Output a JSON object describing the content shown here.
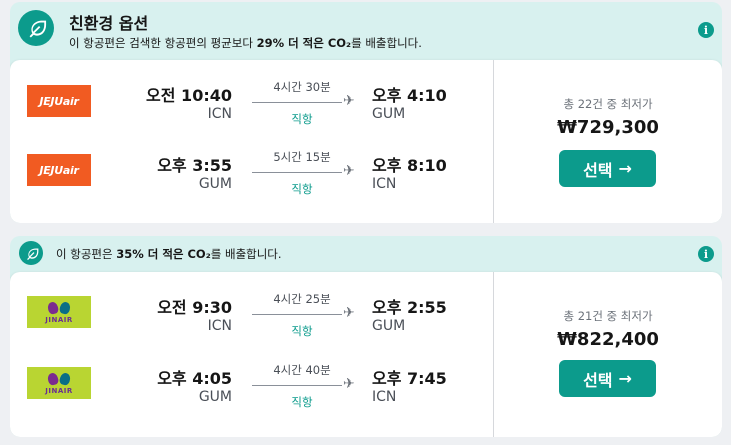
{
  "results": [
    {
      "eco_title": "친환경 옵션",
      "eco_desc_pre": "이 항공편은 검색한 항공편의 평균보다 ",
      "eco_desc_bold": "29% 더 적은 CO₂",
      "eco_desc_post": "를 배출합니다.",
      "info_glyph": "i",
      "legs": [
        {
          "airline": "JEJUair",
          "logo_color": "#f15b22",
          "dep_time": "오전 10:40",
          "dep_code": "ICN",
          "duration": "4시간 30분",
          "stops": "직항",
          "arr_time": "오후 4:10",
          "arr_code": "GUM"
        },
        {
          "airline": "JEJUair",
          "logo_color": "#f15b22",
          "dep_time": "오후 3:55",
          "dep_code": "GUM",
          "duration": "5시간 15분",
          "stops": "직항",
          "arr_time": "오후 8:10",
          "arr_code": "ICN"
        }
      ],
      "price_label": "총 22건 중 최저가",
      "price": "₩729,300",
      "button_label": "선택",
      "button_arrow": "→"
    },
    {
      "eco_desc_pre": "이 항공편은 ",
      "eco_desc_bold": "35% 더 적은 CO₂",
      "eco_desc_post": "를 배출합니다.",
      "info_glyph": "i",
      "legs": [
        {
          "airline": "JINAIR",
          "logo_color": "#b9d532",
          "dep_time": "오전 9:30",
          "dep_code": "ICN",
          "duration": "4시간 25분",
          "stops": "직항",
          "arr_time": "오후 2:55",
          "arr_code": "GUM"
        },
        {
          "airline": "JINAIR",
          "logo_color": "#b9d532",
          "dep_time": "오후 4:05",
          "dep_code": "GUM",
          "duration": "4시간 40분",
          "stops": "직항",
          "arr_time": "오후 7:45",
          "arr_code": "ICN"
        }
      ],
      "price_label": "총 21건 중 최저가",
      "price": "₩822,400",
      "button_label": "선택",
      "button_arrow": "→"
    }
  ],
  "colors": {
    "accent": "#0c9b8c",
    "eco_bg": "#d8f1ef",
    "page_bg": "#eef0f3"
  },
  "icons": {
    "eco": "leaf-icon",
    "info": "info-icon",
    "plane": "airplane-icon",
    "arrow": "arrow-right-icon"
  }
}
